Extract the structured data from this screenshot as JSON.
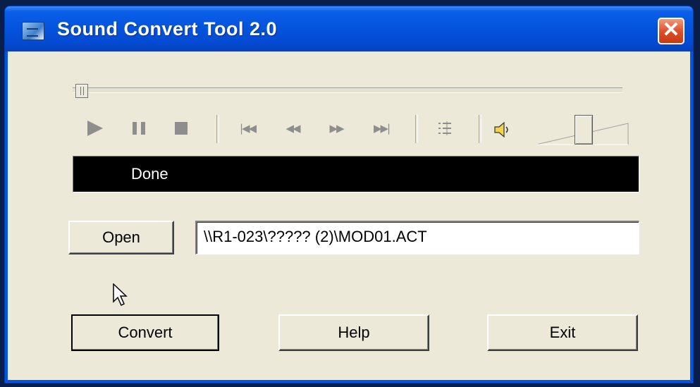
{
  "window": {
    "title": "Sound Convert Tool 2.0",
    "close_glyph": "✕"
  },
  "player": {
    "controls": {
      "play": "play-icon",
      "pause": "pause-icon",
      "stop": "stop-icon",
      "skip_start": "skip-to-start-icon",
      "rewind": "rewind-icon",
      "fast_forward": "fast-forward-icon",
      "skip_end": "skip-to-end-icon",
      "playlist": "playlist-icon",
      "volume": "speaker-icon"
    },
    "status": "Done"
  },
  "file": {
    "open_label": "Open",
    "path": "\\\\R1-023\\????? (2)\\MOD01.ACT"
  },
  "actions": {
    "convert_label": "Convert",
    "help_label": "Help",
    "exit_label": "Exit"
  },
  "colors": {
    "title_bar": "#0453dc",
    "close_button": "#e0502a",
    "client_bg": "#ece9d8",
    "status_bg": "#000000",
    "status_text": "#ffffff"
  }
}
